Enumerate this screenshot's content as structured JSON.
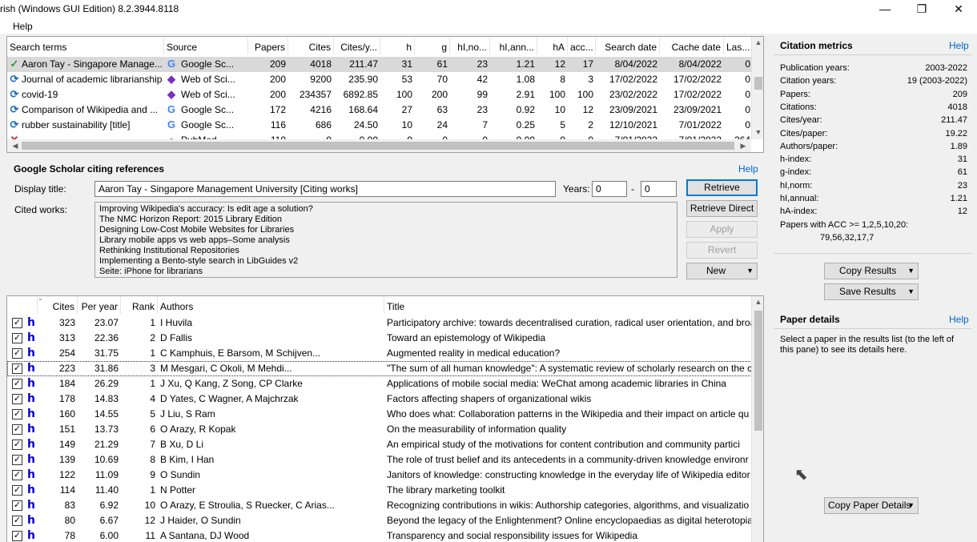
{
  "app": {
    "title": "rish (Windows GUI Edition) 8.2.3944.8118",
    "menu_help": "Help"
  },
  "window_controls": {
    "minimize": "—",
    "restore": "❐",
    "close": "✕"
  },
  "queries": {
    "headers": [
      "Search terms",
      "Source",
      "Papers",
      "Cites",
      "Cites/y...",
      "h",
      "g",
      "hI,no...",
      "hI,ann...",
      "hA",
      "acc...",
      "Search date",
      "Cache date",
      "Las..."
    ],
    "rows": [
      {
        "term": "Aaron Tay - Singapore Manage...",
        "source": "Google Sc...",
        "papers": "209",
        "cites": "4018",
        "cpy": "211.47",
        "h": "31",
        "g": "61",
        "hnorm": "23",
        "hann": "1.21",
        "ha": "12",
        "acc": "17",
        "sdate": "8/04/2022",
        "cdate": "8/04/2022",
        "last": "0"
      },
      {
        "term": "Journal of academic librarianship",
        "source": "Web of Sci...",
        "papers": "200",
        "cites": "9200",
        "cpy": "235.90",
        "h": "53",
        "g": "70",
        "hnorm": "42",
        "hann": "1.08",
        "ha": "8",
        "acc": "3",
        "sdate": "17/02/2022",
        "cdate": "17/02/2022",
        "last": "0"
      },
      {
        "term": "covid-19",
        "source": "Web of Sci...",
        "papers": "200",
        "cites": "234357",
        "cpy": "6892.85",
        "h": "100",
        "g": "200",
        "hnorm": "99",
        "hann": "2.91",
        "ha": "100",
        "acc": "100",
        "sdate": "23/02/2022",
        "cdate": "17/02/2022",
        "last": "0"
      },
      {
        "term": "Comparison of Wikipedia and ...",
        "source": "Google Sc...",
        "papers": "172",
        "cites": "4216",
        "cpy": "168.64",
        "h": "27",
        "g": "63",
        "hnorm": "23",
        "hann": "0.92",
        "ha": "10",
        "acc": "12",
        "sdate": "23/09/2021",
        "cdate": "23/09/2021",
        "last": "0"
      },
      {
        "term": "rubber sustainability [title]",
        "source": "Google Sc...",
        "papers": "116",
        "cites": "686",
        "cpy": "24.50",
        "h": "10",
        "g": "24",
        "hnorm": "7",
        "hann": "0.25",
        "ha": "5",
        "acc": "2",
        "sdate": "12/10/2021",
        "cdate": "7/01/2022",
        "last": "0"
      },
      {
        "term": "",
        "source": "PubMed",
        "papers": "110",
        "cites": "0",
        "cpy": "0.00",
        "h": "0",
        "g": "0",
        "hnorm": "0",
        "hann": "0.00",
        "ha": "0",
        "acc": "0",
        "sdate": "7/01/2022",
        "cdate": "7/01/2022",
        "last": "264"
      }
    ]
  },
  "gs_panel": {
    "title": "Google Scholar citing references",
    "help": "Help",
    "display_title_label": "Display title:",
    "display_title_value": "Aaron Tay - Singapore Management University [Citing works]",
    "years_label": "Years:",
    "year_from": "0",
    "year_dash": "-",
    "year_to": "0",
    "cited_works_label": "Cited works:",
    "cited_works": [
      "Improving Wikipedia's accuracy: Is edit age a solution?",
      "The NMC Horizon Report: 2015 Library Edition",
      "Designing Low-Cost Mobile Websites for Libraries",
      "Library mobile apps vs web apps–Some analysis",
      "Rethinking Institutional Repositories",
      "Implementing a Bento-style search in LibGuides v2",
      "Seite: iPhone for librarians"
    ],
    "buttons": {
      "retrieve": "Retrieve",
      "retrieve_direct": "Retrieve Direct",
      "apply": "Apply",
      "revert": "Revert",
      "new": "New"
    }
  },
  "results": {
    "headers": {
      "cites": "Cites",
      "per_year": "Per year",
      "rank": "Rank",
      "authors": "Authors",
      "title": "Title"
    },
    "rows": [
      {
        "cites": "323",
        "py": "23.07",
        "rank": "1",
        "authors": "I Huvila",
        "title": "Participatory archive: towards decentralised curation, radical user orientation, and broa"
      },
      {
        "cites": "313",
        "py": "22.36",
        "rank": "2",
        "authors": "D Fallis",
        "title": "Toward an epistemology of Wikipedia"
      },
      {
        "cites": "254",
        "py": "31.75",
        "rank": "1",
        "authors": "C Kamphuis, E Barsom, M Schijven...",
        "title": "Augmented reality in medical education?"
      },
      {
        "cites": "223",
        "py": "31.86",
        "rank": "3",
        "authors": "M Mesgari, C Okoli, M Mehdi...",
        "title": "\"The sum of all human knowledge\": A systematic review of scholarly research on the c"
      },
      {
        "cites": "184",
        "py": "26.29",
        "rank": "1",
        "authors": "J Xu, Q Kang, Z Song, CP Clarke",
        "title": "Applications of mobile social media: WeChat among academic libraries in China"
      },
      {
        "cites": "178",
        "py": "14.83",
        "rank": "4",
        "authors": "D Yates, C Wagner, A Majchrzak",
        "title": "Factors affecting shapers of organizational wikis"
      },
      {
        "cites": "160",
        "py": "14.55",
        "rank": "5",
        "authors": "J Liu, S Ram",
        "title": "Who does what: Collaboration patterns in the Wikipedia and their impact on article qu"
      },
      {
        "cites": "151",
        "py": "13.73",
        "rank": "6",
        "authors": "O Arazy, R Kopak",
        "title": "On the measurability of information quality"
      },
      {
        "cites": "149",
        "py": "21.29",
        "rank": "7",
        "authors": "B Xu, D Li",
        "title": "An empirical study of the motivations for content contribution and community partici"
      },
      {
        "cites": "139",
        "py": "10.69",
        "rank": "8",
        "authors": "B Kim, I Han",
        "title": "The role of trust belief and its antecedents in a community-driven knowledge environr"
      },
      {
        "cites": "122",
        "py": "11.09",
        "rank": "9",
        "authors": "O Sundin",
        "title": "Janitors of knowledge: constructing knowledge in the everyday life of Wikipedia editor"
      },
      {
        "cites": "114",
        "py": "11.40",
        "rank": "1",
        "authors": "N Potter",
        "title": "The library marketing toolkit"
      },
      {
        "cites": "83",
        "py": "6.92",
        "rank": "10",
        "authors": "O Arazy, E Stroulia, S Ruecker, C Arias...",
        "title": "Recognizing contributions in wikis: Authorship categories, algorithms, and visualizatio"
      },
      {
        "cites": "80",
        "py": "6.67",
        "rank": "12",
        "authors": "J Haider, O Sundin",
        "title": "Beyond the legacy of the Enlightenment? Online encyclopaedias as digital heterotopias"
      },
      {
        "cites": "78",
        "py": "6.00",
        "rank": "11",
        "authors": "A Santana, DJ Wood",
        "title": "Transparency and social responsibility issues for Wikipedia"
      }
    ]
  },
  "metrics": {
    "title": "Citation metrics",
    "help": "Help",
    "items": [
      {
        "k": "Publication years:",
        "v": "2003-2022"
      },
      {
        "k": "Citation years:",
        "v": "19 (2003-2022)"
      },
      {
        "k": "Papers:",
        "v": "209"
      },
      {
        "k": "Citations:",
        "v": "4018"
      },
      {
        "k": "Cites/year:",
        "v": "211.47"
      },
      {
        "k": "Cites/paper:",
        "v": "19.22"
      },
      {
        "k": "Authors/paper:",
        "v": "1.89"
      },
      {
        "k": "h-index:",
        "v": "31"
      },
      {
        "k": "g-index:",
        "v": "61"
      },
      {
        "k": "hI,norm:",
        "v": "23"
      },
      {
        "k": "hI,annual:",
        "v": "1.21"
      },
      {
        "k": "hA-index:",
        "v": "12"
      }
    ],
    "acc_label": "Papers with ACC >= 1,2,5,10,20:",
    "acc_value": "79,56,32,17,7",
    "copy_results": "Copy Results",
    "save_results": "Save Results"
  },
  "paper_details": {
    "title": "Paper details",
    "help": "Help",
    "text1": "Select a paper in the results list (to the left of",
    "text2": "this pane) to see its details here.",
    "copy_button": "Copy Paper Details"
  },
  "colors": {
    "selected_row": "#d9d9d9",
    "link": "#0066cc",
    "h_icon": "#0000cc",
    "google_g": "#4285f4",
    "check": "#2e9b2e"
  }
}
